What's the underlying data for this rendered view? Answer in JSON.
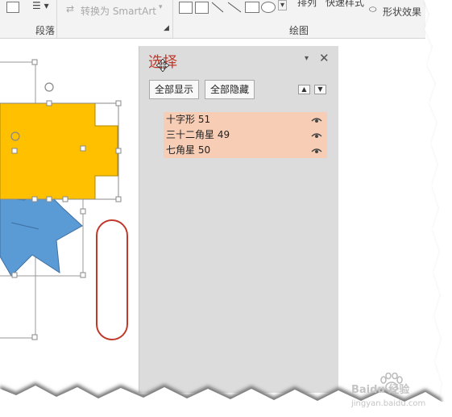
{
  "ribbon": {
    "convert_smartart": "转换为 SmartArt",
    "paragraph_group": "段落",
    "drawing_group": "绘图",
    "arrange": "排列",
    "quick_styles": "快速样式",
    "shape_effects": "形状效果"
  },
  "selection_pane": {
    "title": "选择",
    "show_all": "全部显示",
    "hide_all": "全部隐藏",
    "items": [
      {
        "label": "十字形 51"
      },
      {
        "label": "三十二角星 49"
      },
      {
        "label": "七角星 50"
      }
    ]
  },
  "colors": {
    "cross_fill": "#ffc000",
    "star_fill": "#5b9bd5",
    "pane_bg": "#dcdcdc",
    "item_highlight": "#f7cdb5",
    "annotation_oval": "#c0392b"
  },
  "watermark": {
    "site": "Baidu 经验",
    "url": "jingyan.baidu.com"
  }
}
